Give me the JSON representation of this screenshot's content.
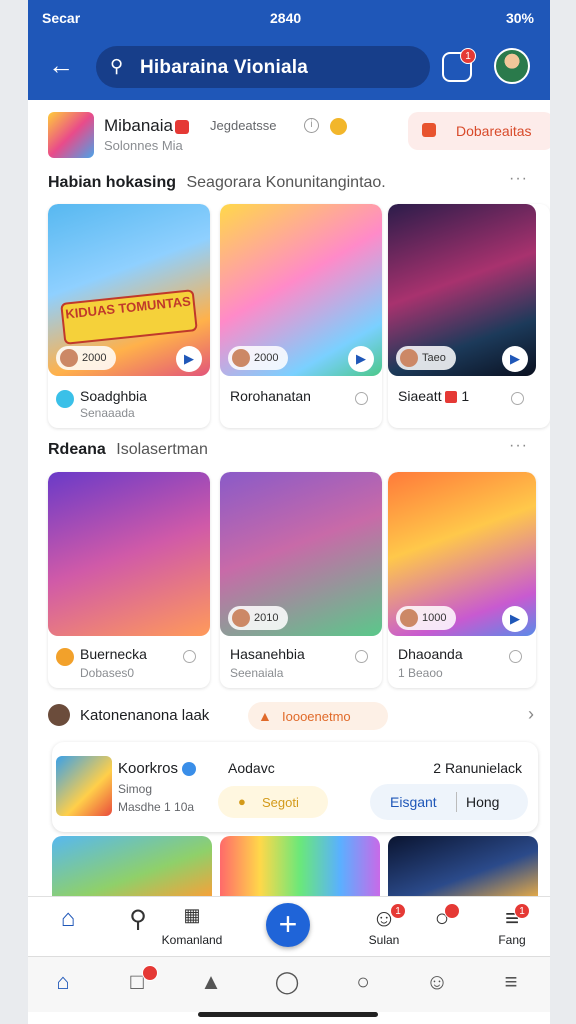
{
  "status": {
    "carrier": "Secar",
    "time": "2840",
    "battery": "30%"
  },
  "search": {
    "query": "Hibaraina Vioniala"
  },
  "channel": {
    "name": "Mibanaia",
    "sub": "Solonnes Mia",
    "meta": "Jegdeatsse",
    "button": "Dobareaitas"
  },
  "section1": {
    "title": "Habian hokasing",
    "subtitle": "Seagorara Konunitangintao.",
    "cards": [
      {
        "pill": "2000",
        "title": "Soadghbia",
        "sub": "Senaaada",
        "overlay": "KIDUAS TOMUNTAS"
      },
      {
        "pill": "2000",
        "title": "Rorohanatan",
        "sub": ""
      },
      {
        "pill": "Taeo",
        "title": "Siaeatt",
        "sub": "",
        "count": "1"
      }
    ]
  },
  "section2": {
    "title": "Rdeana",
    "subtitle": "Isolasertman",
    "cards": [
      {
        "pill": "",
        "title": "Buernecka",
        "sub": "Dobases0"
      },
      {
        "pill": "2010",
        "title": "Hasanehbia",
        "sub": "Seenaiala"
      },
      {
        "pill": "1000",
        "title": "Dhaoanda",
        "sub": "1 Beaoo"
      }
    ]
  },
  "featured": {
    "title": "Katonenanona laak",
    "tag": "Ioooenetmo"
  },
  "promo": {
    "name": "Koorkros",
    "line2": "Simog",
    "line3": "Masdhe 1 10a",
    "mid": "Aodavc",
    "small_button": "Segoti",
    "right": "2 Ranunielack",
    "seg_a": "Eisgant",
    "seg_b": "Hong"
  },
  "tabbar": {
    "items": [
      {
        "label": "",
        "icon": "home-icon"
      },
      {
        "label": "",
        "icon": "search-icon"
      },
      {
        "label": "Komanland",
        "icon": "grid-icon"
      },
      {
        "label": "Sulan",
        "icon": "user-icon"
      },
      {
        "label": "",
        "icon": "chat-icon"
      },
      {
        "label": "Fang",
        "icon": "menu-icon"
      }
    ],
    "badges": [
      "1",
      "1",
      "1"
    ]
  },
  "colors": {
    "brand": "#1f57b8",
    "accent_red": "#e53935",
    "accent_orange": "#e06a2a"
  }
}
